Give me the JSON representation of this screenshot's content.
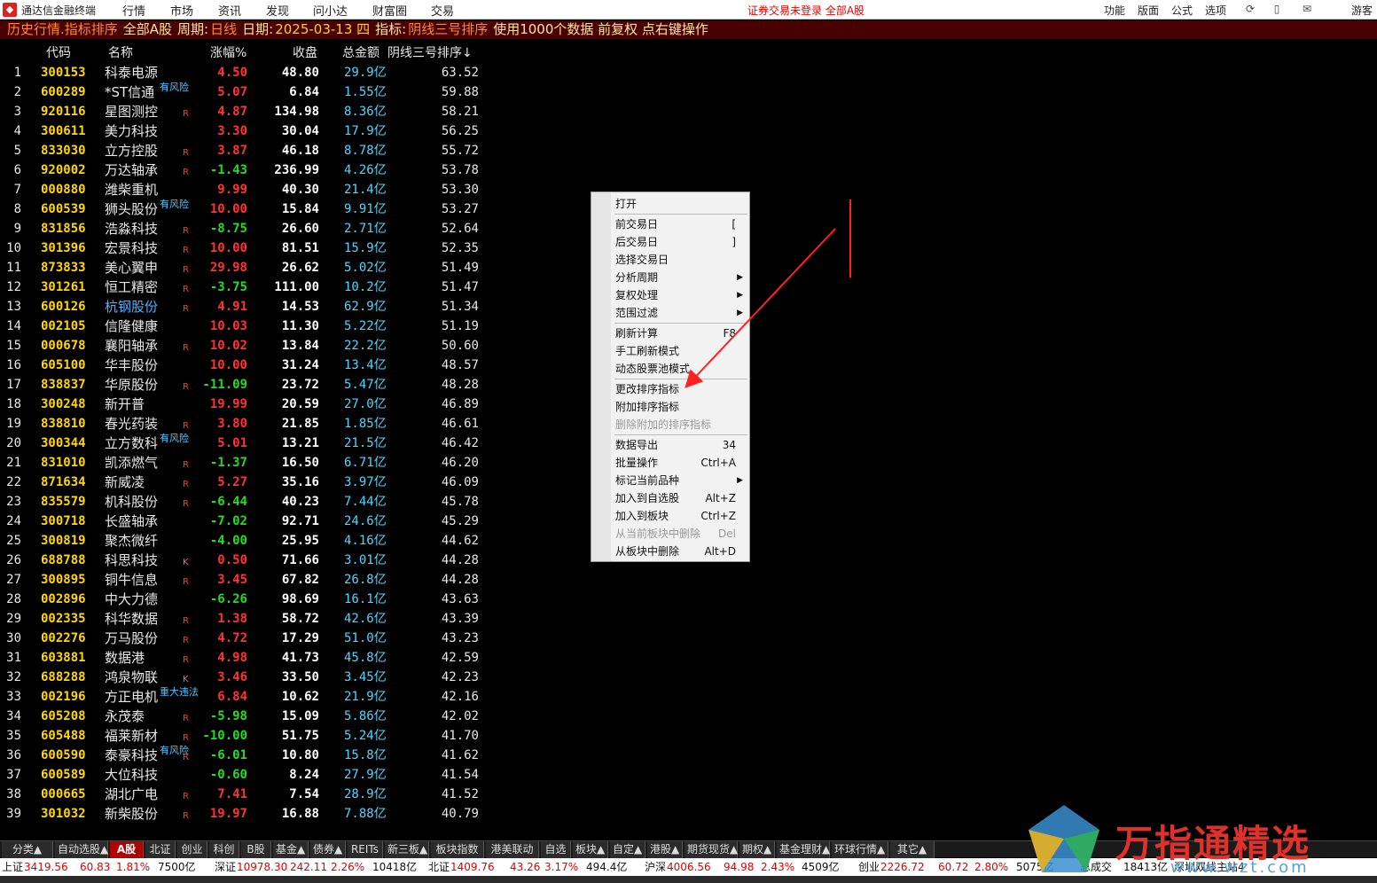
{
  "titlebar": {
    "app_name": "通达信金融终端",
    "menus": [
      "行情",
      "市场",
      "资讯",
      "发现",
      "问小达",
      "财富圈",
      "交易"
    ],
    "alert": "证券交易未登录  全部A股",
    "right_menus": [
      "功能",
      "版面",
      "公式",
      "选项"
    ],
    "user": "游客"
  },
  "infobar": {
    "mode": "历史行情.指标排序",
    "scope": "全部A股",
    "period_label": "周期:",
    "period": "日线",
    "date_label": "日期:",
    "date": "2025-03-13 四",
    "indicator_label": "指标:",
    "indicator": "阴线三号排序",
    "note": "使用1000个数据 前复权 点右键操作"
  },
  "table": {
    "headers": {
      "code": "代码",
      "name": "名称",
      "pct": "涨幅%",
      "close": "收盘",
      "amount": "总金额",
      "sort": "阴线三号排序↓"
    },
    "rows": [
      {
        "idx": "1",
        "code": "300153",
        "name": "科泰电源",
        "tag": "",
        "flag": "",
        "pct": "4.50",
        "dir": "up",
        "close": "48.80",
        "amount": "29.9亿",
        "sort": "63.52"
      },
      {
        "idx": "2",
        "code": "600289",
        "name": "*ST信通",
        "tag": "有风险",
        "flag": "",
        "pct": "5.07",
        "dir": "up",
        "close": "6.84",
        "amount": "1.55亿",
        "sort": "59.88"
      },
      {
        "idx": "3",
        "code": "920116",
        "name": "星图测控",
        "tag": "",
        "flag": "R",
        "pct": "4.87",
        "dir": "up",
        "close": "134.98",
        "amount": "8.36亿",
        "sort": "58.21"
      },
      {
        "idx": "4",
        "code": "300611",
        "name": "美力科技",
        "tag": "",
        "flag": "",
        "pct": "3.30",
        "dir": "up",
        "close": "30.04",
        "amount": "17.9亿",
        "sort": "56.25"
      },
      {
        "idx": "5",
        "code": "833030",
        "name": "立方控股",
        "tag": "",
        "flag": "R",
        "pct": "3.87",
        "dir": "up",
        "close": "46.18",
        "amount": "8.78亿",
        "sort": "55.72"
      },
      {
        "idx": "6",
        "code": "920002",
        "name": "万达轴承",
        "tag": "",
        "flag": "R",
        "pct": "-1.43",
        "dir": "down",
        "close": "236.99",
        "amount": "4.26亿",
        "sort": "53.78"
      },
      {
        "idx": "7",
        "code": "000880",
        "name": "潍柴重机",
        "tag": "",
        "flag": "",
        "pct": "9.99",
        "dir": "up",
        "close": "40.30",
        "amount": "21.4亿",
        "sort": "53.30"
      },
      {
        "idx": "8",
        "code": "600539",
        "name": "狮头股份",
        "tag": "有风险",
        "flag": "",
        "pct": "10.00",
        "dir": "up",
        "close": "15.84",
        "amount": "9.91亿",
        "sort": "53.27"
      },
      {
        "idx": "9",
        "code": "831856",
        "name": "浩淼科技",
        "tag": "",
        "flag": "R",
        "pct": "-8.75",
        "dir": "down",
        "close": "26.60",
        "amount": "2.71亿",
        "sort": "52.64"
      },
      {
        "idx": "10",
        "code": "301396",
        "name": "宏景科技",
        "tag": "",
        "flag": "R",
        "pct": "10.00",
        "dir": "up",
        "close": "81.51",
        "amount": "15.9亿",
        "sort": "52.35"
      },
      {
        "idx": "11",
        "code": "873833",
        "name": "美心翼申",
        "tag": "",
        "flag": "R",
        "pct": "29.98",
        "dir": "up",
        "close": "26.62",
        "amount": "5.02亿",
        "sort": "51.49"
      },
      {
        "idx": "12",
        "code": "301261",
        "name": "恒工精密",
        "tag": "",
        "flag": "R",
        "pct": "-3.75",
        "dir": "down",
        "close": "111.00",
        "amount": "10.2亿",
        "sort": "51.47"
      },
      {
        "idx": "13",
        "code": "600126",
        "name": "杭钢股份",
        "tag": "",
        "flag": "R",
        "pct": "4.91",
        "dir": "up",
        "close": "14.53",
        "amount": "62.9亿",
        "sort": "51.34",
        "blue": true
      },
      {
        "idx": "14",
        "code": "002105",
        "name": "信隆健康",
        "tag": "",
        "flag": "",
        "pct": "10.03",
        "dir": "up",
        "close": "11.30",
        "amount": "5.22亿",
        "sort": "51.19"
      },
      {
        "idx": "15",
        "code": "000678",
        "name": "襄阳轴承",
        "tag": "",
        "flag": "R",
        "pct": "10.02",
        "dir": "up",
        "close": "13.84",
        "amount": "22.2亿",
        "sort": "50.60"
      },
      {
        "idx": "16",
        "code": "605100",
        "name": "华丰股份",
        "tag": "",
        "flag": "",
        "pct": "10.00",
        "dir": "up",
        "close": "31.24",
        "amount": "13.4亿",
        "sort": "48.57"
      },
      {
        "idx": "17",
        "code": "838837",
        "name": "华原股份",
        "tag": "",
        "flag": "R",
        "pct": "-11.09",
        "dir": "down",
        "close": "23.72",
        "amount": "5.47亿",
        "sort": "48.28"
      },
      {
        "idx": "18",
        "code": "300248",
        "name": "新开普",
        "tag": "",
        "flag": "",
        "pct": "19.99",
        "dir": "up",
        "close": "20.59",
        "amount": "27.0亿",
        "sort": "46.89"
      },
      {
        "idx": "19",
        "code": "838810",
        "name": "春光药装",
        "tag": "",
        "flag": "R",
        "pct": "3.80",
        "dir": "up",
        "close": "21.85",
        "amount": "1.85亿",
        "sort": "46.61"
      },
      {
        "idx": "20",
        "code": "300344",
        "name": "立方数科",
        "tag": "有风险",
        "flag": "",
        "pct": "5.01",
        "dir": "up",
        "close": "13.21",
        "amount": "21.5亿",
        "sort": "46.42"
      },
      {
        "idx": "21",
        "code": "831010",
        "name": "凯添燃气",
        "tag": "",
        "flag": "R",
        "pct": "-1.37",
        "dir": "down",
        "close": "16.50",
        "amount": "6.71亿",
        "sort": "46.20"
      },
      {
        "idx": "22",
        "code": "871634",
        "name": "新威凌",
        "tag": "",
        "flag": "R",
        "pct": "5.27",
        "dir": "up",
        "close": "35.16",
        "amount": "3.97亿",
        "sort": "46.09"
      },
      {
        "idx": "23",
        "code": "835579",
        "name": "机科股份",
        "tag": "",
        "flag": "R",
        "pct": "-6.44",
        "dir": "down",
        "close": "40.23",
        "amount": "7.44亿",
        "sort": "45.78"
      },
      {
        "idx": "24",
        "code": "300718",
        "name": "长盛轴承",
        "tag": "",
        "flag": "",
        "pct": "-7.02",
        "dir": "down",
        "close": "92.71",
        "amount": "24.6亿",
        "sort": "45.29"
      },
      {
        "idx": "25",
        "code": "300819",
        "name": "聚杰微纤",
        "tag": "",
        "flag": "",
        "pct": "-4.00",
        "dir": "down",
        "close": "25.95",
        "amount": "4.16亿",
        "sort": "44.62"
      },
      {
        "idx": "26",
        "code": "688788",
        "name": "科思科技",
        "tag": "",
        "flag": "K",
        "pct": "0.50",
        "dir": "up",
        "close": "71.66",
        "amount": "3.01亿",
        "sort": "44.28"
      },
      {
        "idx": "27",
        "code": "300895",
        "name": "铜牛信息",
        "tag": "",
        "flag": "R",
        "pct": "3.45",
        "dir": "up",
        "close": "67.82",
        "amount": "26.8亿",
        "sort": "44.28"
      },
      {
        "idx": "28",
        "code": "002896",
        "name": "中大力德",
        "tag": "",
        "flag": "",
        "pct": "-6.26",
        "dir": "down",
        "close": "98.69",
        "amount": "16.1亿",
        "sort": "43.63"
      },
      {
        "idx": "29",
        "code": "002335",
        "name": "科华数据",
        "tag": "",
        "flag": "R",
        "pct": "1.38",
        "dir": "up",
        "close": "58.72",
        "amount": "42.6亿",
        "sort": "43.39"
      },
      {
        "idx": "30",
        "code": "002276",
        "name": "万马股份",
        "tag": "",
        "flag": "R",
        "pct": "4.72",
        "dir": "up",
        "close": "17.29",
        "amount": "51.0亿",
        "sort": "43.23"
      },
      {
        "idx": "31",
        "code": "603881",
        "name": "数据港",
        "tag": "",
        "flag": "R",
        "pct": "4.98",
        "dir": "up",
        "close": "41.73",
        "amount": "45.8亿",
        "sort": "42.59"
      },
      {
        "idx": "32",
        "code": "688288",
        "name": "鸿泉物联",
        "tag": "",
        "flag": "K",
        "pct": "3.46",
        "dir": "up",
        "close": "33.50",
        "amount": "3.45亿",
        "sort": "42.23"
      },
      {
        "idx": "33",
        "code": "002196",
        "name": "方正电机",
        "tag": "重大违法",
        "flag": "",
        "pct": "6.84",
        "dir": "up",
        "close": "10.62",
        "amount": "21.9亿",
        "sort": "42.16"
      },
      {
        "idx": "34",
        "code": "605208",
        "name": "永茂泰",
        "tag": "",
        "flag": "R",
        "pct": "-5.98",
        "dir": "down",
        "close": "15.09",
        "amount": "5.86亿",
        "sort": "42.02"
      },
      {
        "idx": "35",
        "code": "605488",
        "name": "福莱新材",
        "tag": "",
        "flag": "R",
        "pct": "-10.00",
        "dir": "down",
        "close": "51.75",
        "amount": "5.24亿",
        "sort": "41.70"
      },
      {
        "idx": "36",
        "code": "600590",
        "name": "泰豪科技",
        "tag": "有风险",
        "flag": "R",
        "pct": "-6.01",
        "dir": "down",
        "close": "10.80",
        "amount": "15.8亿",
        "sort": "41.62"
      },
      {
        "idx": "37",
        "code": "600589",
        "name": "大位科技",
        "tag": "",
        "flag": "",
        "pct": "-0.60",
        "dir": "down",
        "close": "8.24",
        "amount": "27.9亿",
        "sort": "41.54"
      },
      {
        "idx": "38",
        "code": "000665",
        "name": "湖北广电",
        "tag": "",
        "flag": "R",
        "pct": "7.41",
        "dir": "up",
        "close": "7.54",
        "amount": "28.9亿",
        "sort": "41.52"
      },
      {
        "idx": "39",
        "code": "301032",
        "name": "新柴股份",
        "tag": "",
        "flag": "R",
        "pct": "19.97",
        "dir": "up",
        "close": "16.88",
        "amount": "7.88亿",
        "sort": "40.79"
      }
    ]
  },
  "context_menu": {
    "items": [
      {
        "label": "打开",
        "shortcut": "",
        "sub": false,
        "disabled": false
      },
      {
        "sep": true
      },
      {
        "label": "前交易日",
        "shortcut": "[",
        "sub": false,
        "disabled": false
      },
      {
        "label": "后交易日",
        "shortcut": "]",
        "sub": false,
        "disabled": false
      },
      {
        "label": "选择交易日",
        "shortcut": "",
        "sub": false,
        "disabled": false
      },
      {
        "label": "分析周期",
        "shortcut": "",
        "sub": true,
        "disabled": false
      },
      {
        "label": "复权处理",
        "shortcut": "",
        "sub": true,
        "disabled": false
      },
      {
        "label": "范围过滤",
        "shortcut": "",
        "sub": true,
        "disabled": false
      },
      {
        "sep": true
      },
      {
        "label": "刷新计算",
        "shortcut": "F8",
        "sub": false,
        "disabled": false
      },
      {
        "label": "手工刷新模式",
        "shortcut": "",
        "sub": false,
        "disabled": false
      },
      {
        "label": "动态股票池模式",
        "shortcut": "",
        "sub": false,
        "disabled": false
      },
      {
        "sep": true
      },
      {
        "label": "更改排序指标",
        "shortcut": "",
        "sub": false,
        "disabled": false
      },
      {
        "label": "附加排序指标",
        "shortcut": "",
        "sub": false,
        "disabled": false
      },
      {
        "label": "删除附加的排序指标",
        "shortcut": "",
        "sub": false,
        "disabled": true
      },
      {
        "sep": true
      },
      {
        "label": "数据导出",
        "shortcut": "34",
        "sub": false,
        "disabled": false
      },
      {
        "label": "批量操作",
        "shortcut": "Ctrl+A",
        "sub": false,
        "disabled": false
      },
      {
        "label": "标记当前品种",
        "shortcut": "",
        "sub": true,
        "disabled": false
      },
      {
        "label": "加入到自选股",
        "shortcut": "Alt+Z",
        "sub": false,
        "disabled": false
      },
      {
        "label": "加入到板块",
        "shortcut": "Ctrl+Z",
        "sub": false,
        "disabled": false
      },
      {
        "label": "从当前板块中删除",
        "shortcut": "Del",
        "sub": false,
        "disabled": true
      },
      {
        "label": "从板块中删除",
        "shortcut": "Alt+D",
        "sub": false,
        "disabled": false
      }
    ]
  },
  "tabs": [
    "分类▲",
    "自动选股▲",
    "A股",
    "北证",
    "创业",
    "科创",
    "B股",
    "基金▲",
    "债券▲",
    "REITs",
    "新三板▲",
    "板块指数",
    "港美联动",
    "自选",
    "板块▲",
    "自定▲",
    "港股▲",
    "期货现货▲",
    "期权▲",
    "基金理财▲",
    "环球行情▲",
    "其它▲"
  ],
  "active_tab": "A股",
  "status": {
    "sh_label": "上证",
    "sh_val": "3419.56",
    "sh_chg": "60.83",
    "sh_pct": "1.81%",
    "sh_amt": "7500亿",
    "sz_label": "深证",
    "sz_val": "10978.30",
    "sz_chg": "242.11",
    "sz_pct": "2.26%",
    "sz_amt": "10418亿",
    "bz_label": "北证",
    "bz_val": "1409.76",
    "bz_chg": "43.26",
    "bz_pct": "3.17%",
    "bz_amt": "494.4亿",
    "hs_label": "沪深",
    "hs_val": "4006.56",
    "hs_chg": "94.98",
    "hs_pct": "2.43%",
    "hs_amt": "4509亿",
    "cy_label": "创业",
    "cy_val": "2226.72",
    "cy_chg": "60.72",
    "cy_pct": "2.80%",
    "cy_amt": "5075亿",
    "total_label": "总成交",
    "total_val": "18413亿",
    "conn": "深圳双线主站4"
  },
  "watermark": {
    "brand": "万指通精选",
    "url": "www.wzt.com"
  },
  "colors": {
    "up": "#ff3333",
    "down": "#22dd22",
    "code": "#ffd700",
    "amount": "#4fd8ff",
    "annot": "#ff2020"
  }
}
